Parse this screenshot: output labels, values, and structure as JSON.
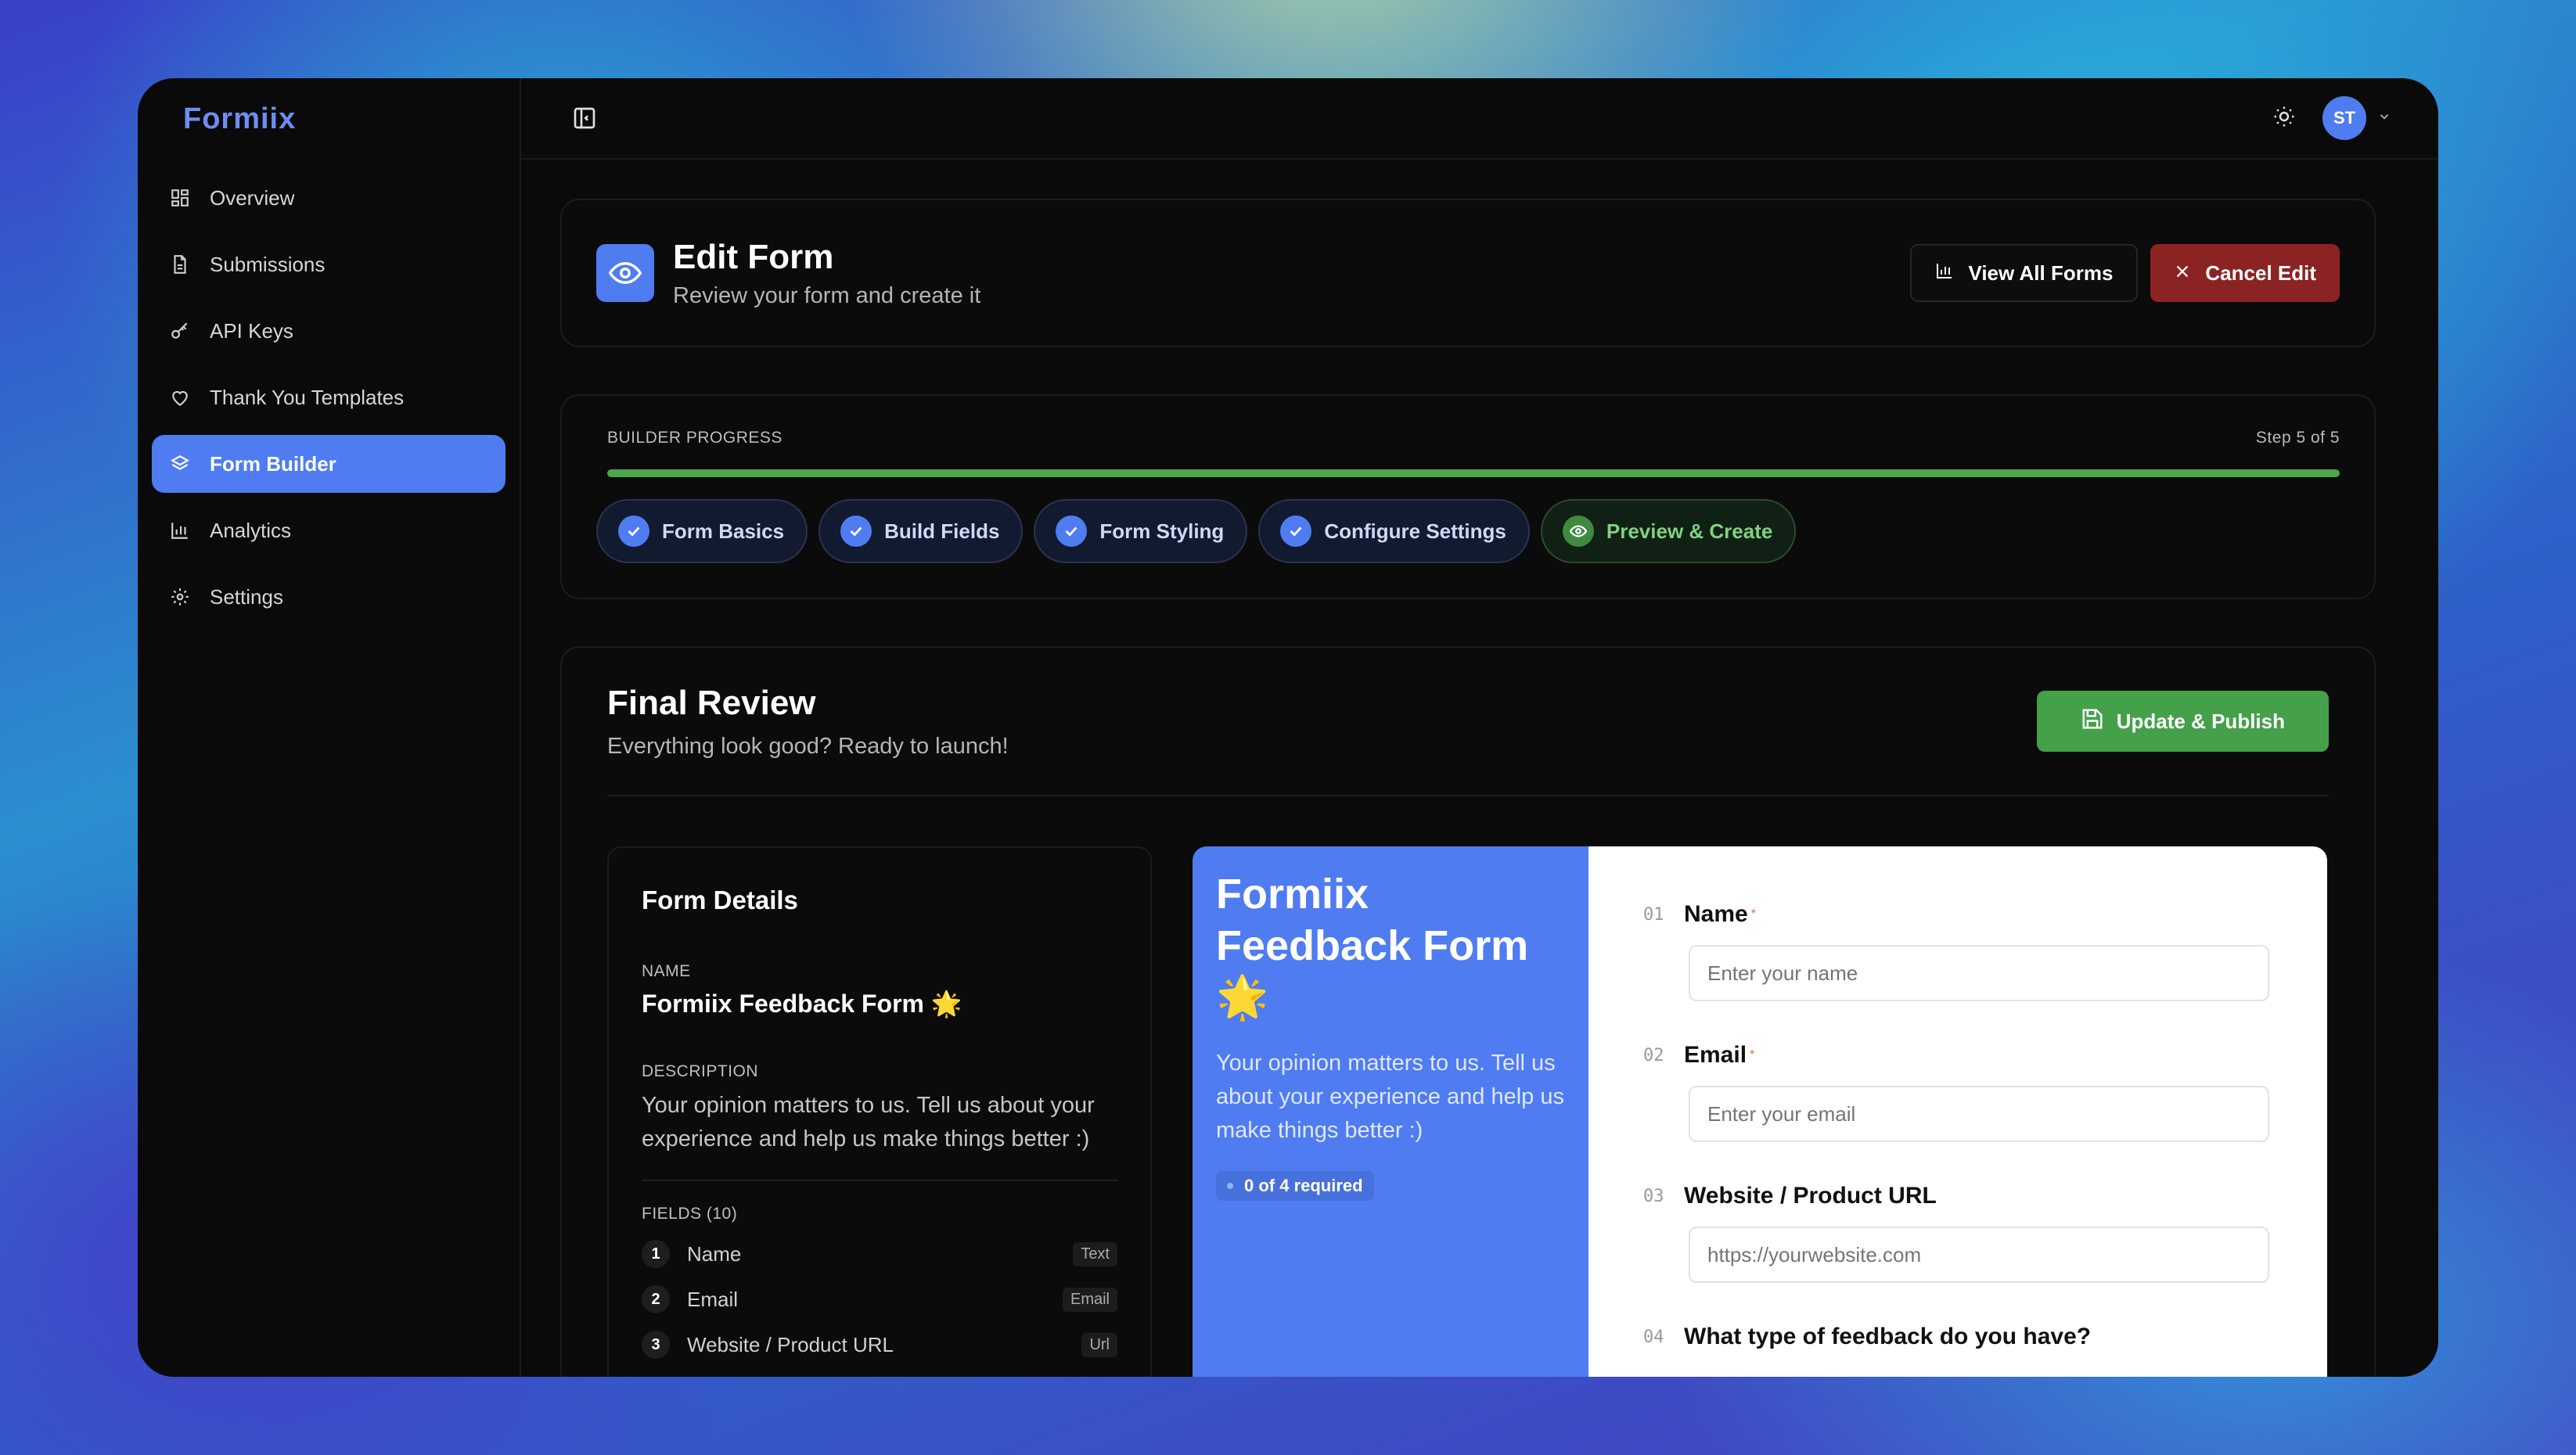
{
  "app": {
    "brand": "Formiix"
  },
  "sidebar": {
    "items": [
      {
        "label": "Overview",
        "icon": "grid-icon"
      },
      {
        "label": "Submissions",
        "icon": "document-icon"
      },
      {
        "label": "API Keys",
        "icon": "key-icon"
      },
      {
        "label": "Thank You Templates",
        "icon": "heart-icon"
      },
      {
        "label": "Form Builder",
        "icon": "layers-icon",
        "active": true
      },
      {
        "label": "Analytics",
        "icon": "bar-chart-icon"
      },
      {
        "label": "Settings",
        "icon": "gear-icon"
      }
    ]
  },
  "topbar": {
    "avatar_initials": "ST",
    "theme_icon": "sun-icon"
  },
  "header": {
    "title": "Edit Form",
    "subtitle": "Review your form and create it",
    "view_all_label": "View All Forms",
    "cancel_label": "Cancel Edit"
  },
  "progress": {
    "label": "BUILDER PROGRESS",
    "step_text": "Step 5 of 5",
    "fraction": 1.0,
    "steps": [
      {
        "label": "Form Basics",
        "done": true
      },
      {
        "label": "Build Fields",
        "done": true
      },
      {
        "label": "Form Styling",
        "done": true
      },
      {
        "label": "Configure Settings",
        "done": true
      },
      {
        "label": "Preview & Create",
        "current": true
      }
    ]
  },
  "review": {
    "title": "Final Review",
    "subtitle": "Everything look good? Ready to launch!",
    "publish_label": "Update & Publish"
  },
  "details": {
    "title": "Form Details",
    "name_label": "NAME",
    "name": "Formiix Feedback Form 🌟",
    "description_label": "DESCRIPTION",
    "description": "Your opinion matters to us. Tell us about your experience and help us make things better :)",
    "fields_label": "FIELDS (10)",
    "fields": [
      {
        "num": "1",
        "name": "Name",
        "type": "Text"
      },
      {
        "num": "2",
        "name": "Email",
        "type": "Email"
      },
      {
        "num": "3",
        "name": "Website / Product URL",
        "type": "Url"
      }
    ]
  },
  "preview": {
    "title": "Formiix Feedback Form 🌟",
    "description": "Your opinion matters to us. Tell us about your experience and help us make things better :)",
    "required_pill": "0 of 4 required",
    "questions": [
      {
        "num": "01",
        "label": "Name",
        "required": true,
        "placeholder": "Enter your name"
      },
      {
        "num": "02",
        "label": "Email",
        "required": true,
        "placeholder": "Enter your email"
      },
      {
        "num": "03",
        "label": "Website / Product URL",
        "required": false,
        "placeholder": "https://yourwebsite.com"
      },
      {
        "num": "04",
        "label": "What type of feedback do you have?",
        "required": false
      }
    ]
  },
  "colors": {
    "accent": "#4f7cf0",
    "success": "#45a04a",
    "danger": "#8c2323"
  }
}
